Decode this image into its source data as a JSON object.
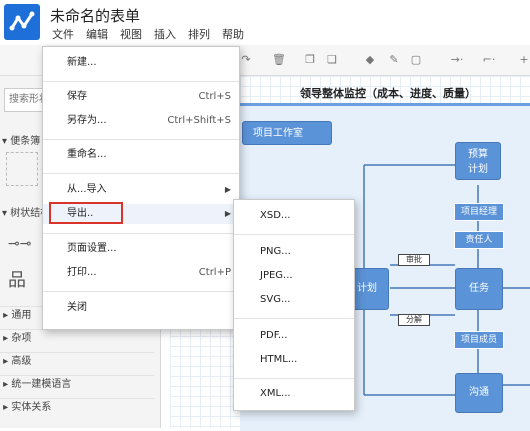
{
  "app": {
    "title": "未命名的表单"
  },
  "menubar": [
    "文件",
    "编辑",
    "视图",
    "插入",
    "排列",
    "帮助"
  ],
  "sidebar": {
    "search_placeholder": "搜索形状",
    "section_favorites": "便条簿",
    "section_tree": "树状结构",
    "categories": [
      "通用",
      "杂项",
      "高级",
      "统一建模语言",
      "实体关系"
    ]
  },
  "diagram": {
    "title": "领导整体监控（成本、进度、质量）",
    "studio_label": "项目工作室",
    "nodes": {
      "budget_plan": "预算\n计划",
      "plan": "计划",
      "task": "任务",
      "communicate": "沟通"
    },
    "tags": {
      "project_manager": "项目经理",
      "responsible": "责任人",
      "project_member": "项目成员"
    },
    "edge_labels": {
      "review": "审批",
      "decompose": "分解"
    }
  },
  "file_menu": {
    "items": [
      {
        "label": "新建...",
        "shortcut": "",
        "submenu": false
      },
      {
        "label": "保存",
        "shortcut": "Ctrl+S",
        "submenu": false
      },
      {
        "label": "另存为...",
        "shortcut": "Ctrl+Shift+S",
        "submenu": false
      },
      {
        "label": "重命名...",
        "shortcut": "",
        "submenu": false
      },
      {
        "label": "从...导入",
        "shortcut": "",
        "submenu": true
      },
      {
        "label": "导出..",
        "shortcut": "",
        "submenu": true,
        "highlighted": true
      },
      {
        "label": "页面设置...",
        "shortcut": "",
        "submenu": false
      },
      {
        "label": "打印...",
        "shortcut": "Ctrl+P",
        "submenu": false
      },
      {
        "label": "关闭",
        "shortcut": "",
        "submenu": false
      }
    ]
  },
  "export_submenu": {
    "items": [
      "XSD...",
      "PNG...",
      "JPEG...",
      "SVG...",
      "PDF...",
      "HTML...",
      "XML..."
    ]
  },
  "colors": {
    "accent": "#1f6fd8",
    "highlight_border": "#d9342b",
    "node_fill": "#5b93d8",
    "frame_fill": "#e6f0fb"
  }
}
